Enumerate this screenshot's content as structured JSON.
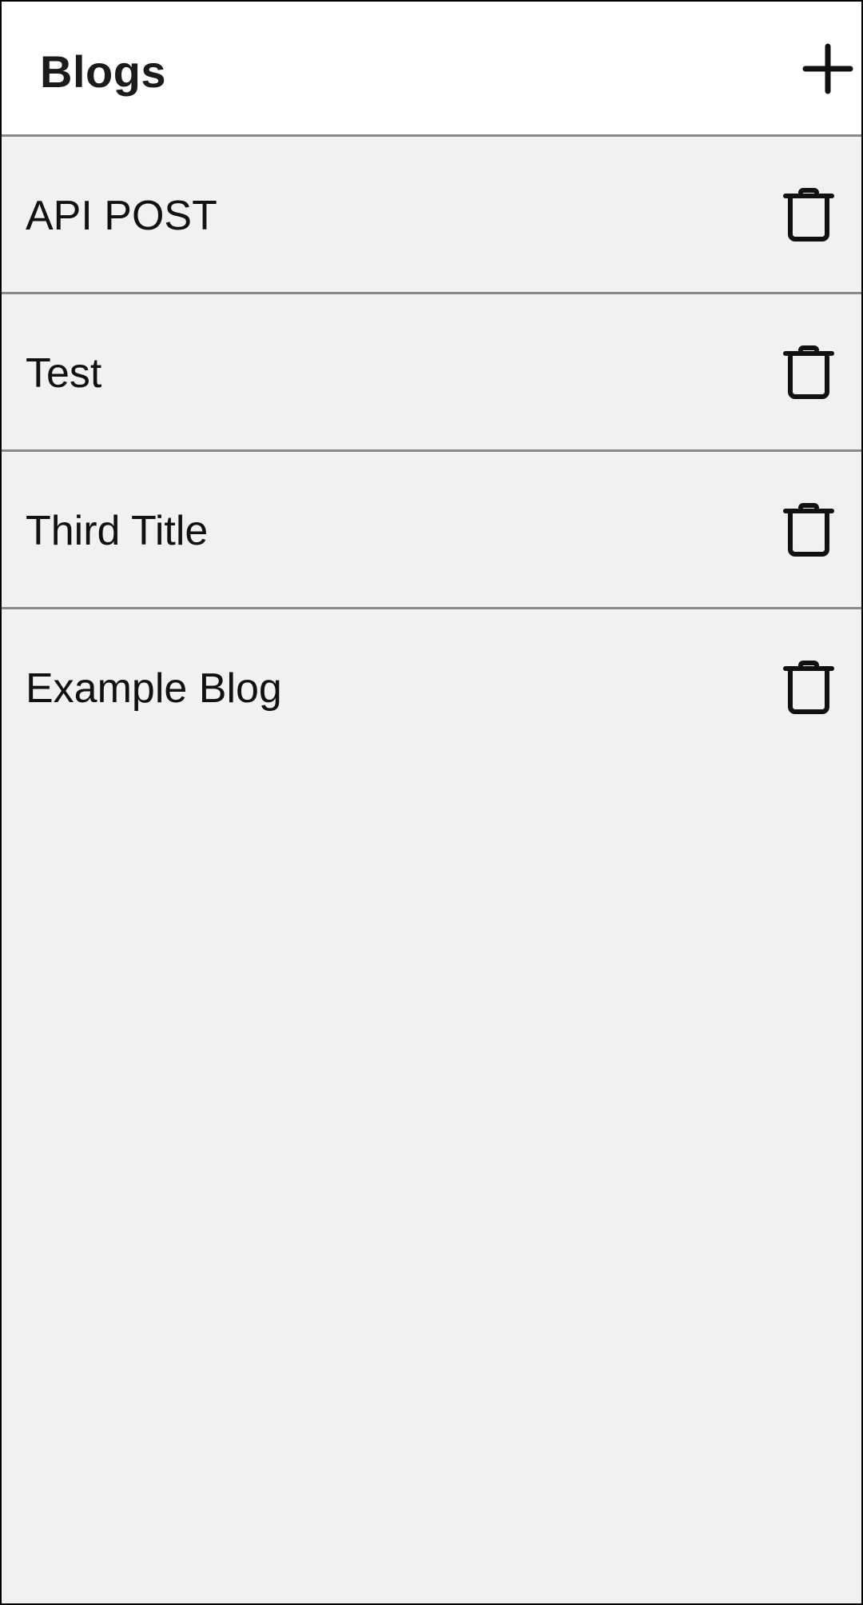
{
  "header": {
    "title": "Blogs",
    "add_icon": "plus-icon"
  },
  "blogs": [
    {
      "title": "API POST",
      "delete_icon": "trash-icon"
    },
    {
      "title": "Test",
      "delete_icon": "trash-icon"
    },
    {
      "title": "Third Title",
      "delete_icon": "trash-icon"
    },
    {
      "title": "Example Blog",
      "delete_icon": "trash-icon"
    }
  ],
  "colors": {
    "header_background": "#ffffff",
    "list_background": "#f1f1f1",
    "divider": "#8a8a8a",
    "text": "#111111"
  }
}
